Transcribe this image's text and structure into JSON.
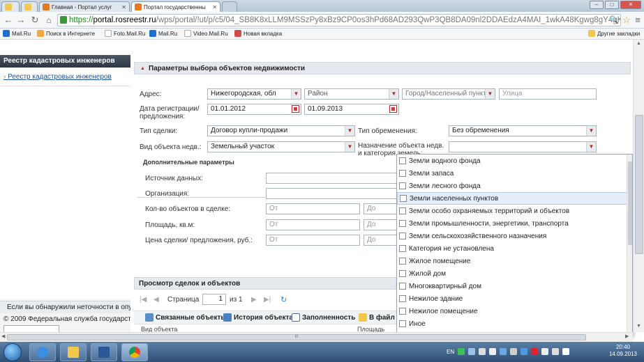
{
  "browser": {
    "tabs": [
      {
        "label": "Главная - Портал услуг"
      },
      {
        "label": "Портал государственны"
      }
    ],
    "url": {
      "scheme": "https://",
      "domain": "portal.rosreestr.ru",
      "path": "/wps/portal/!ut/p/c5/04_SB8K8xLLM9MSSzPy8xBz9CP0os3hPd68AD293QwP3QB8DA09nl2DDAEdzA4MAI_1wkA48Kgwg8gY4gKOBvp9H"
    },
    "bookmarks": [
      "Mail.Ru",
      "Поиск в Интернете",
      "Foto.Mail.Ru",
      "Mail.Ru",
      "Video.Mail.Ru",
      "Новая вкладка"
    ],
    "other_bookmarks": "Другие закладки",
    "accent": "#e8791e"
  },
  "sidebar": {
    "header": "Реестр кадастровых инженеров",
    "link": "Реестр кадастровых инженеров",
    "error_notice": "Если вы обнаружили неточности в опу",
    "copyright": "© 2009 Федеральная служба государсте"
  },
  "form": {
    "section_title": "Параметры выбора объектов недвижимости",
    "address_label": "Адрес:",
    "region": "Нижегородская, обл",
    "district_ph": "Район",
    "city_ph": "Город/Населенный пункт",
    "street_ph": "Улица",
    "reg_date_label": "Дата регистрации/ предложения:",
    "date_from": "01.01.2012",
    "date_to": "01.09.2013",
    "deal_type_label": "Тип сделки:",
    "deal_type": "Договор купли-продажи",
    "encumbrance_label": "Тип обременения:",
    "encumbrance": "Без обременения",
    "object_type_label": "Вид объекта недв.:",
    "object_type": "Земельный участок",
    "purpose_label": "Назначение объекта недв. и категория земель:",
    "extra_title": "Дополнительные параметры",
    "source_label": "Источник данных:",
    "org_label": "Организация:",
    "count_label": "Кол-во объектов в сделке:",
    "area_label": "Площадь, кв.м:",
    "price_label": "Цена сделки/ предложения, руб.:",
    "from_ph": "От",
    "to_ph": "До"
  },
  "results": {
    "title": "Просмотр сделок и объектов",
    "page_label": "Страница",
    "page_value": "1",
    "page_of": "из 1",
    "toolbar": [
      "Связанные объекты",
      "История объекта",
      "Заполненность",
      "В файл C"
    ],
    "col_object": "Вид объекта",
    "col_area": "Площадь"
  },
  "dropdown": {
    "items": [
      "Земли водного фонда",
      "Земли запаса",
      "Земли лесного фонда",
      "Земли населенных пунктов",
      "Земли особо охраняемых территорий и объектов",
      "Земли промышленности, энергетики, транспорта",
      "Земли сельскохозяйственного назначения",
      "Категория не установлена",
      "Жилое помещение",
      "Жилой дом",
      "Многоквартирный дом",
      "Нежилое здание",
      "Нежилое помещение",
      "Иное"
    ],
    "highlighted": "Земли населенных пунктов"
  },
  "taskbar": {
    "lang": "EN",
    "time": "20:40",
    "date": "14.09.2013"
  }
}
